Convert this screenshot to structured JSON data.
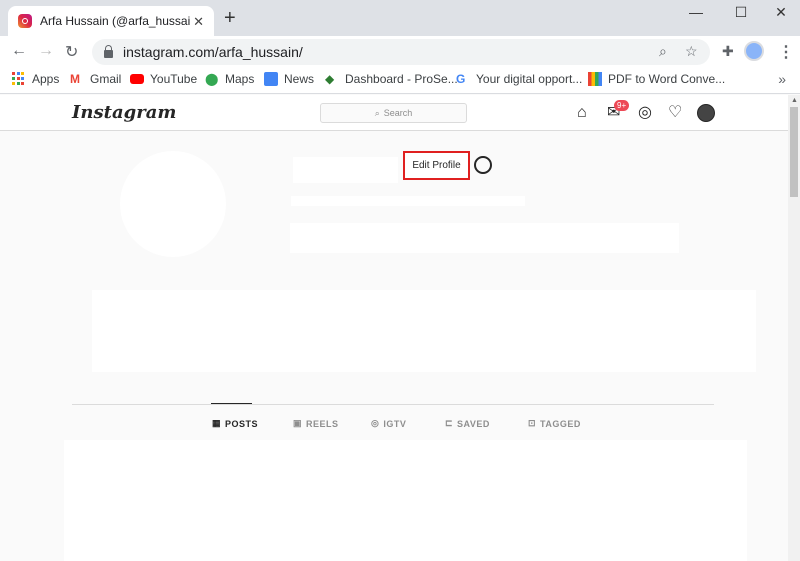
{
  "browser": {
    "tab_title": "Arfa Hussain (@arfa_hussain) • In",
    "tab_close": "✕",
    "new_tab": "+",
    "url": "instagram.com/arfa_hussain/",
    "window_controls": {
      "minimize": "—",
      "maximize": "☐",
      "close": "✕"
    }
  },
  "bookmarks": [
    {
      "label": "Apps",
      "icon": "apps-grid-icon"
    },
    {
      "label": "Gmail",
      "icon": "gmail-icon"
    },
    {
      "label": "YouTube",
      "icon": "youtube-icon"
    },
    {
      "label": "Maps",
      "icon": "maps-icon"
    },
    {
      "label": "News",
      "icon": "news-icon"
    },
    {
      "label": "Dashboard - ProSe...",
      "icon": "dashboard-icon"
    },
    {
      "label": "Your digital opport...",
      "icon": "google-icon"
    },
    {
      "label": "PDF to Word Conve...",
      "icon": "pdf-icon"
    }
  ],
  "bookmarks_more": "»",
  "instagram": {
    "logo": "Instagram",
    "search_placeholder": "Search",
    "messages_badge": "9+",
    "edit_profile_label": "Edit Profile",
    "tabs": [
      {
        "label": "POSTS",
        "icon": "▦"
      },
      {
        "label": "REELS",
        "icon": "▣"
      },
      {
        "label": "IGTV",
        "icon": "◎"
      },
      {
        "label": "SAVED",
        "icon": "⊏"
      },
      {
        "label": "TAGGED",
        "icon": "⊡"
      }
    ],
    "active_tab": "POSTS"
  },
  "colors": {
    "highlight_box": "#e02020",
    "badge": "#ed4956"
  }
}
